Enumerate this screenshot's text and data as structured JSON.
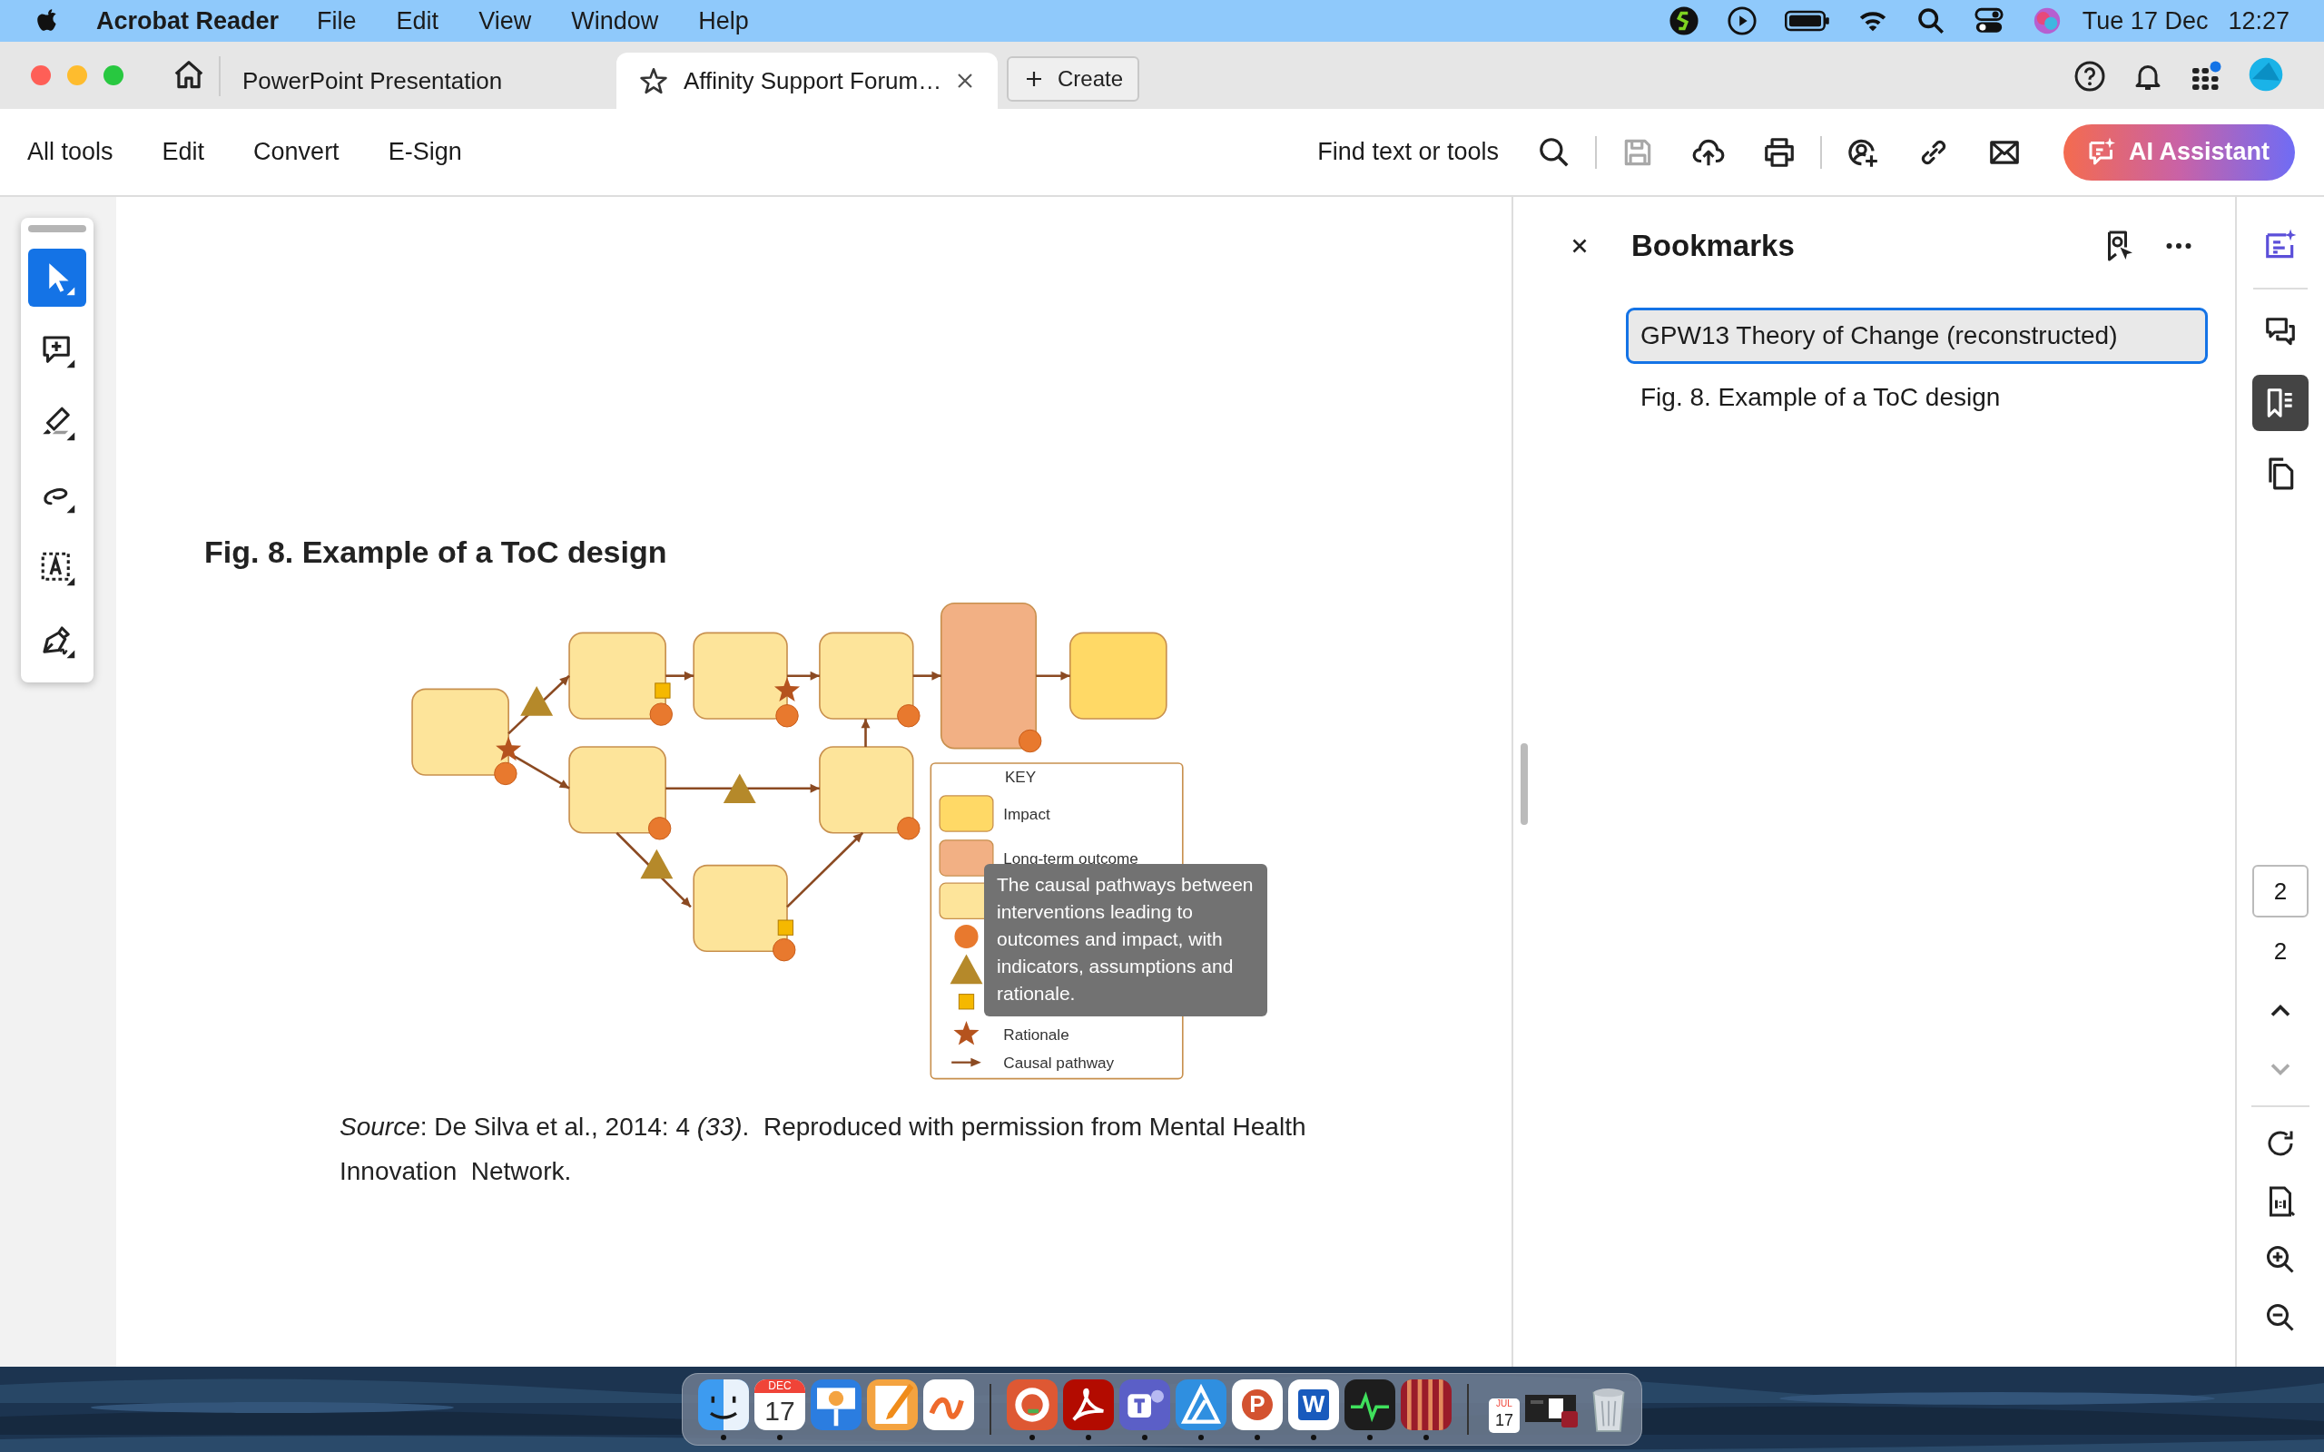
{
  "menu_bar": {
    "app": "Acrobat Reader",
    "menus": [
      "File",
      "Edit",
      "View",
      "Window",
      "Help"
    ],
    "date": "Tue 17 Dec",
    "time": "12:27"
  },
  "tabs": [
    {
      "label": "PowerPoint Presentation",
      "selected": false
    },
    {
      "label": "Affinity Support Forum…",
      "selected": true
    }
  ],
  "create_button": "Create",
  "toolbar": {
    "menus": [
      "All tools",
      "Edit",
      "Convert",
      "E-Sign"
    ],
    "search": "Find text or tools",
    "save_disabled": true,
    "ai_button": "AI Assistant"
  },
  "tools": [
    {
      "kind": "select",
      "selected": true
    },
    {
      "kind": "comment",
      "selected": false
    },
    {
      "kind": "highlight",
      "selected": false
    },
    {
      "kind": "draw",
      "selected": false
    },
    {
      "kind": "text-select",
      "selected": false
    },
    {
      "kind": "sign",
      "selected": false
    }
  ],
  "document": {
    "heading": "Fig. 8. Example of a ToC design",
    "legend": {
      "title": "KEY",
      "items": [
        {
          "kind": "box",
          "color": "#ffd966",
          "label": "Impact"
        },
        {
          "kind": "box",
          "color": "#f2b084",
          "label": "Long-term outcome"
        },
        {
          "kind": "box",
          "color": "#fde49a"
        },
        {
          "kind": "circle"
        },
        {
          "kind": "triangle"
        },
        {
          "kind": "square"
        },
        {
          "kind": "star",
          "label": "Rationale"
        },
        {
          "kind": "arrow",
          "label": "Causal pathway"
        }
      ]
    },
    "tooltip": "The causal pathways between interventions leading to outcomes and impact, with indicators, assumptions and rationale.",
    "caption": "*Source*: De Silva et al., 2014: 4 *(33)*.  Reproduced with permission from Mental Health Innovation  Network."
  },
  "bookmarks": {
    "title": "Bookmarks",
    "items": [
      {
        "label": "GPW13 Theory of Change (reconstructed)",
        "selected": true
      },
      {
        "label": "Fig. 8. Example of a ToC design",
        "selected": false
      }
    ]
  },
  "rail": {
    "panels": [
      {
        "kind": "ai",
        "selected": false
      },
      {
        "kind": "comments",
        "selected": false
      },
      {
        "kind": "bookmarks",
        "selected": true
      },
      {
        "kind": "pages",
        "selected": false
      }
    ],
    "page_field": "2",
    "page_count": "2"
  },
  "dock": {
    "apps": [
      {
        "kind": "finder",
        "running": true
      },
      {
        "kind": "calendar",
        "month": "DEC",
        "day": "17",
        "running": true
      },
      {
        "kind": "keynote",
        "running": false
      },
      {
        "kind": "pages",
        "running": false
      },
      {
        "kind": "freeform",
        "running": false
      },
      {
        "kind": "duck",
        "running": true
      },
      {
        "kind": "acrobat",
        "running": true
      },
      {
        "kind": "teams",
        "running": true
      },
      {
        "kind": "affinity",
        "running": true
      },
      {
        "kind": "powerpoint",
        "glyph": "P",
        "running": true
      },
      {
        "kind": "word",
        "glyph": "W",
        "running": true
      },
      {
        "kind": "monitor",
        "running": true
      },
      {
        "kind": "publisher",
        "running": true
      }
    ],
    "recent": [
      {
        "kind": "calendar",
        "month": "JUL",
        "day": "17"
      },
      {
        "kind": "window"
      }
    ]
  }
}
